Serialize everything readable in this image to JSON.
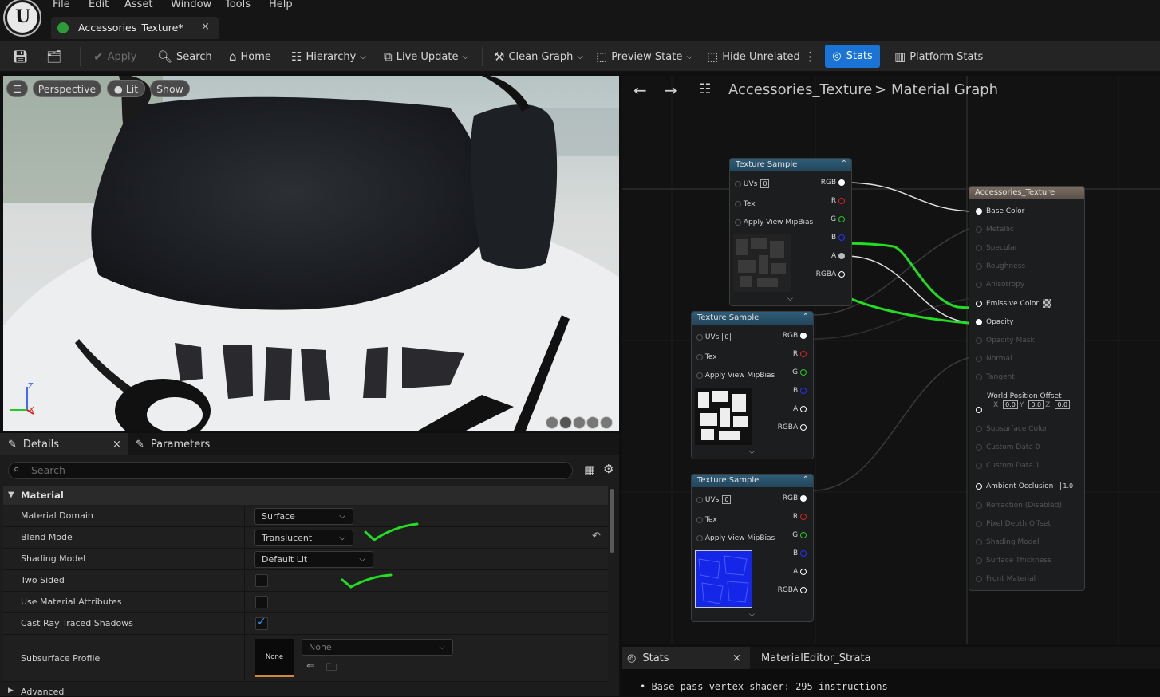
{
  "menu": [
    "File",
    "Edit",
    "Asset",
    "Window",
    "Tools",
    "Help"
  ],
  "doc_tab": {
    "title": "Accessories_Texture*",
    "close": "×"
  },
  "toolbar": {
    "apply": "Apply",
    "search": "Search",
    "home": "Home",
    "hierarchy": "Hierarchy",
    "live_update": "Live Update",
    "clean_graph": "Clean Graph",
    "preview_state": "Preview State",
    "hide_unrelated": "Hide Unrelated",
    "stats": "Stats",
    "platform_stats": "Platform Stats"
  },
  "viewport": {
    "perspective": "Perspective",
    "lit": "Lit",
    "show": "Show",
    "axis_z": "Z",
    "axis_x": "X"
  },
  "details": {
    "tab_details": "Details",
    "tab_close": "×",
    "tab_parameters": "Parameters",
    "search_placeholder": "Search",
    "category": "Material",
    "material_domain_label": "Material Domain",
    "material_domain": "Surface",
    "blend_mode_label": "Blend Mode",
    "blend_mode": "Translucent",
    "shading_model_label": "Shading Model",
    "shading_model": "Default Lit",
    "two_sided_label": "Two Sided",
    "two_sided": false,
    "use_material_attributes_label": "Use Material Attributes",
    "use_material_attributes": false,
    "cast_ray_traced_shadows_label": "Cast Ray Traced Shadows",
    "cast_ray_traced_shadows": true,
    "subsurface_profile_label": "Subsurface Profile",
    "subsurface_thumb": "None",
    "subsurface_value": "None",
    "advanced": "Advanced"
  },
  "graph": {
    "breadcrumb_asset": "Accessories_Texture",
    "breadcrumb_sep": ">",
    "breadcrumb_graph": "Material Graph",
    "texture_nodes": [
      {
        "title": "Texture Sample",
        "uvs": "UVs",
        "uvs_val": "0",
        "tex": "Tex",
        "mip": "Apply View MipBias",
        "rgb": "RGB",
        "r": "R",
        "g": "G",
        "b": "B",
        "a": "A",
        "rgba": "RGBA"
      },
      {
        "title": "Texture Sample",
        "uvs": "UVs",
        "uvs_val": "0",
        "tex": "Tex",
        "mip": "Apply View MipBias",
        "rgb": "RGB",
        "r": "R",
        "g": "G",
        "b": "B",
        "a": "A",
        "rgba": "RGBA"
      },
      {
        "title": "Texture Sample",
        "uvs": "UVs",
        "uvs_val": "0",
        "tex": "Tex",
        "mip": "Apply View MipBias",
        "rgb": "RGB",
        "r": "R",
        "g": "G",
        "b": "B",
        "a": "A",
        "rgba": "RGBA"
      }
    ],
    "material_node": {
      "title": "Accessories_Texture",
      "pins": [
        "Base Color",
        "Metallic",
        "Specular",
        "Roughness",
        "Anisotropy",
        "Emissive Color",
        "Opacity",
        "Opacity Mask",
        "Normal",
        "Tangent",
        "World Position Offset",
        "Subsurface Color",
        "Custom Data 0",
        "Custom Data 1",
        "Ambient Occlusion",
        "Refraction (Disabled)",
        "Pixel Depth Offset",
        "Shading Model",
        "Surface Thickness",
        "Front Material"
      ],
      "wpo_x_label": "X",
      "wpo_x": "0.0",
      "wpo_y_label": "Y",
      "wpo_y": "0.0",
      "wpo_z_label": "Z",
      "wpo_z": "0.0",
      "ao_value": "1.0"
    }
  },
  "stats_panel": {
    "tab_stats": "Stats",
    "tab_close": "×",
    "tab_strata": "MaterialEditor_Strata",
    "line1": "Base pass vertex shader: 295 instructions"
  },
  "colors": {
    "accent": "#1a74d6",
    "annotation": "#22dd22",
    "node_header": "#2e5d78"
  }
}
